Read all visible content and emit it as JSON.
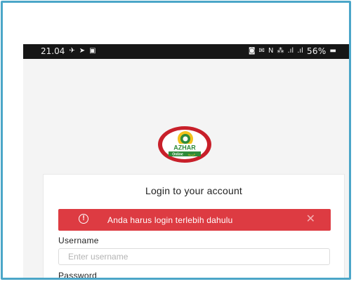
{
  "statusbar": {
    "time": "21.04",
    "left_icons": [
      "plane-icon",
      "telegram-icon",
      "message-icon"
    ],
    "right_icons": [
      "camera-icon",
      "mail-icon",
      "nfc-icon",
      "hotspot-icon",
      "signal-icon",
      "signal-icon-2"
    ],
    "battery": "56%"
  },
  "logo": {
    "text": "AZHAR",
    "sub": "Online",
    "arabic": "عربية"
  },
  "card": {
    "title": "Login to your account"
  },
  "alert": {
    "message": "Anda harus login terlebih dahulu",
    "close": "✕"
  },
  "form": {
    "username_label": "Username",
    "username_placeholder": "Enter username",
    "password_label": "Password"
  },
  "colors": {
    "frame": "#4ba6c8",
    "alert": "#dd3b42",
    "logo_red": "#c8202a",
    "logo_green": "#2e8b3a",
    "logo_yellow": "#f2c21b"
  }
}
